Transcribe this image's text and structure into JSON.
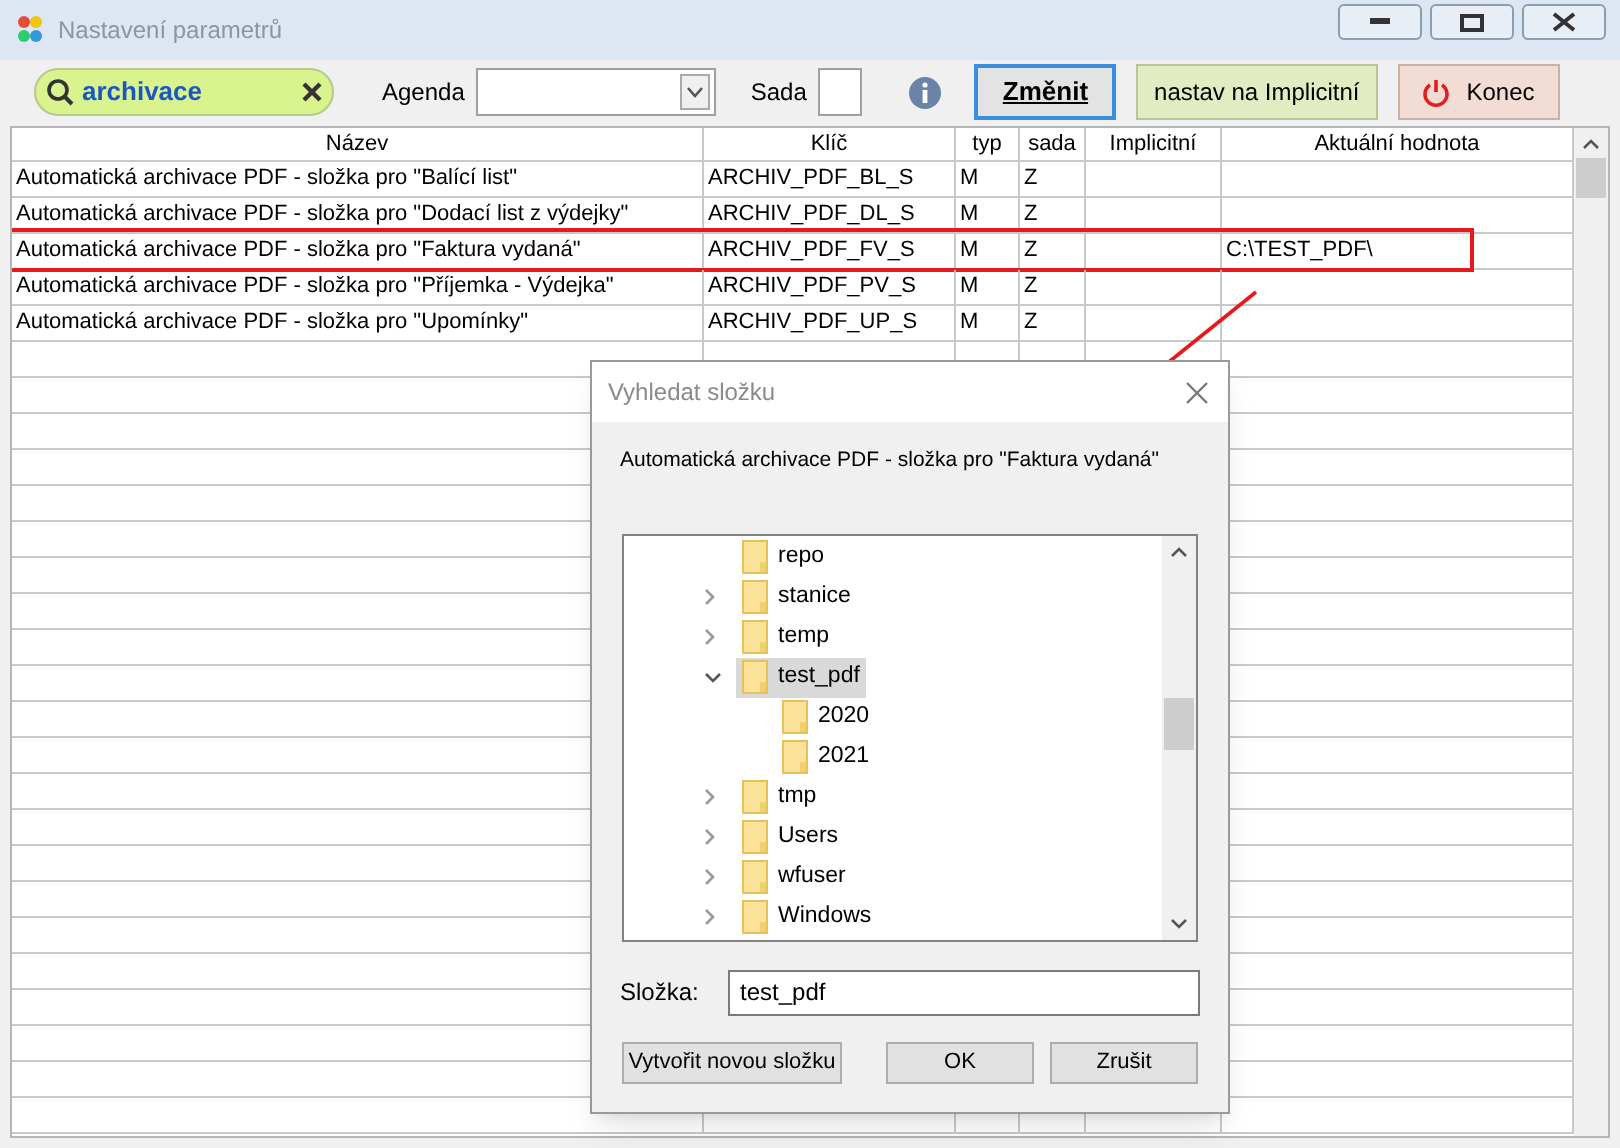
{
  "window": {
    "title": "Nastavení parametrů"
  },
  "toolbar": {
    "search": {
      "value": "archivace"
    },
    "agenda": {
      "label": "Agenda"
    },
    "sada": {
      "label": "Sada"
    },
    "buttons": [
      {
        "label": "Změnit",
        "kind": "focused"
      },
      {
        "label": "nastav na Implicitní",
        "kind": "green"
      },
      {
        "label": "Konec",
        "kind": "exit"
      }
    ]
  },
  "table": {
    "columns": [
      "Název",
      "Klíč",
      "typ",
      "sada",
      "Implicitní",
      "Aktuální hodnota"
    ],
    "rows": [
      {
        "cells": [
          "Automatická archivace PDF - složka pro \"Balící list\"",
          "ARCHIV_PDF_BL_S",
          "M",
          "Z",
          "",
          ""
        ],
        "highlighted": false
      },
      {
        "cells": [
          "Automatická archivace PDF - složka pro \"Dodací list z výdejky\"",
          "ARCHIV_PDF_DL_S",
          "M",
          "Z",
          "",
          ""
        ],
        "highlighted": false
      },
      {
        "cells": [
          "Automatická archivace PDF - složka pro \"Faktura vydaná\"",
          "ARCHIV_PDF_FV_S",
          "M",
          "Z",
          "",
          "C:\\TEST_PDF\\"
        ],
        "highlighted": true
      },
      {
        "cells": [
          "Automatická archivace PDF - složka pro \"Příjemka - Výdejka\"",
          "ARCHIV_PDF_PV_S",
          "M",
          "Z",
          "",
          ""
        ],
        "highlighted": false
      },
      {
        "cells": [
          "Automatická archivace PDF - složka pro \"Upomínky\"",
          "ARCHIV_PDF_UP_S",
          "M",
          "Z",
          "",
          ""
        ],
        "highlighted": false
      }
    ]
  },
  "dialog": {
    "title": "Vyhledat složku",
    "message": "Automatická archivace PDF - složka pro \"Faktura vydaná\"",
    "tree": [
      {
        "label": "repo",
        "selected": false
      },
      {
        "label": "stanice",
        "expanded": false,
        "selected": false
      },
      {
        "label": "temp",
        "expanded": false,
        "selected": false
      },
      {
        "label": "test_pdf",
        "expanded": true,
        "selected": true,
        "children": [
          {
            "label": "2020",
            "selected": false
          },
          {
            "label": "2021",
            "selected": false
          }
        ]
      },
      {
        "label": "tmp",
        "expanded": false,
        "selected": false
      },
      {
        "label": "Users",
        "expanded": false,
        "selected": false
      },
      {
        "label": "wfuser",
        "expanded": false,
        "selected": false
      },
      {
        "label": "Windows",
        "expanded": false,
        "selected": false
      }
    ],
    "folder_label": "Složka:",
    "folder_value": "test_pdf",
    "buttons": [
      "Vytvořit novou složku",
      "OK",
      "Zrušit"
    ]
  }
}
